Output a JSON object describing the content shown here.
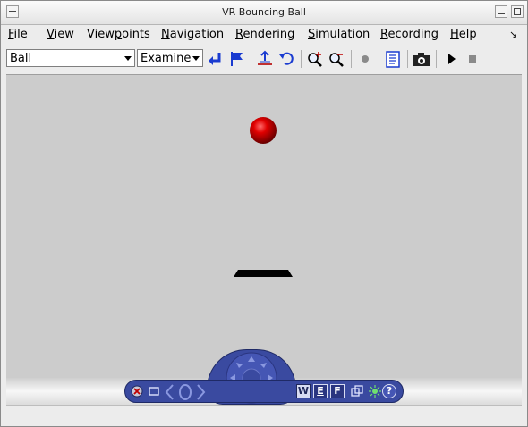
{
  "window": {
    "title": "VR Bouncing Ball"
  },
  "menu": {
    "items": [
      {
        "pre": "",
        "ul": "F",
        "post": "ile"
      },
      {
        "pre": "",
        "ul": "V",
        "post": "iew"
      },
      {
        "pre": "View",
        "ul": "p",
        "post": "oints"
      },
      {
        "pre": "",
        "ul": "N",
        "post": "avigation"
      },
      {
        "pre": "",
        "ul": "R",
        "post": "endering"
      },
      {
        "pre": "",
        "ul": "S",
        "post": "imulation"
      },
      {
        "pre": "",
        "ul": "R",
        "post": "ecording"
      },
      {
        "pre": "",
        "ul": "H",
        "post": "elp"
      }
    ]
  },
  "toolbar": {
    "viewpoint_select": "Ball",
    "navigation_select": "Examine"
  },
  "navpanel": {
    "walk_label": "W",
    "examine_label": "E",
    "fly_label": "F",
    "help_label": "?"
  },
  "colors": {
    "ball": "#e00000",
    "panel": "#3a4aa0",
    "viewport_bg": "#cccccc"
  },
  "icons": [
    "return-icon",
    "flag-icon",
    "straighten-icon",
    "undo-move-icon",
    "zoom-in-icon",
    "zoom-out-icon",
    "record-dot-icon",
    "clipboard-icon",
    "camera-icon",
    "play-icon",
    "stop-icon"
  ]
}
